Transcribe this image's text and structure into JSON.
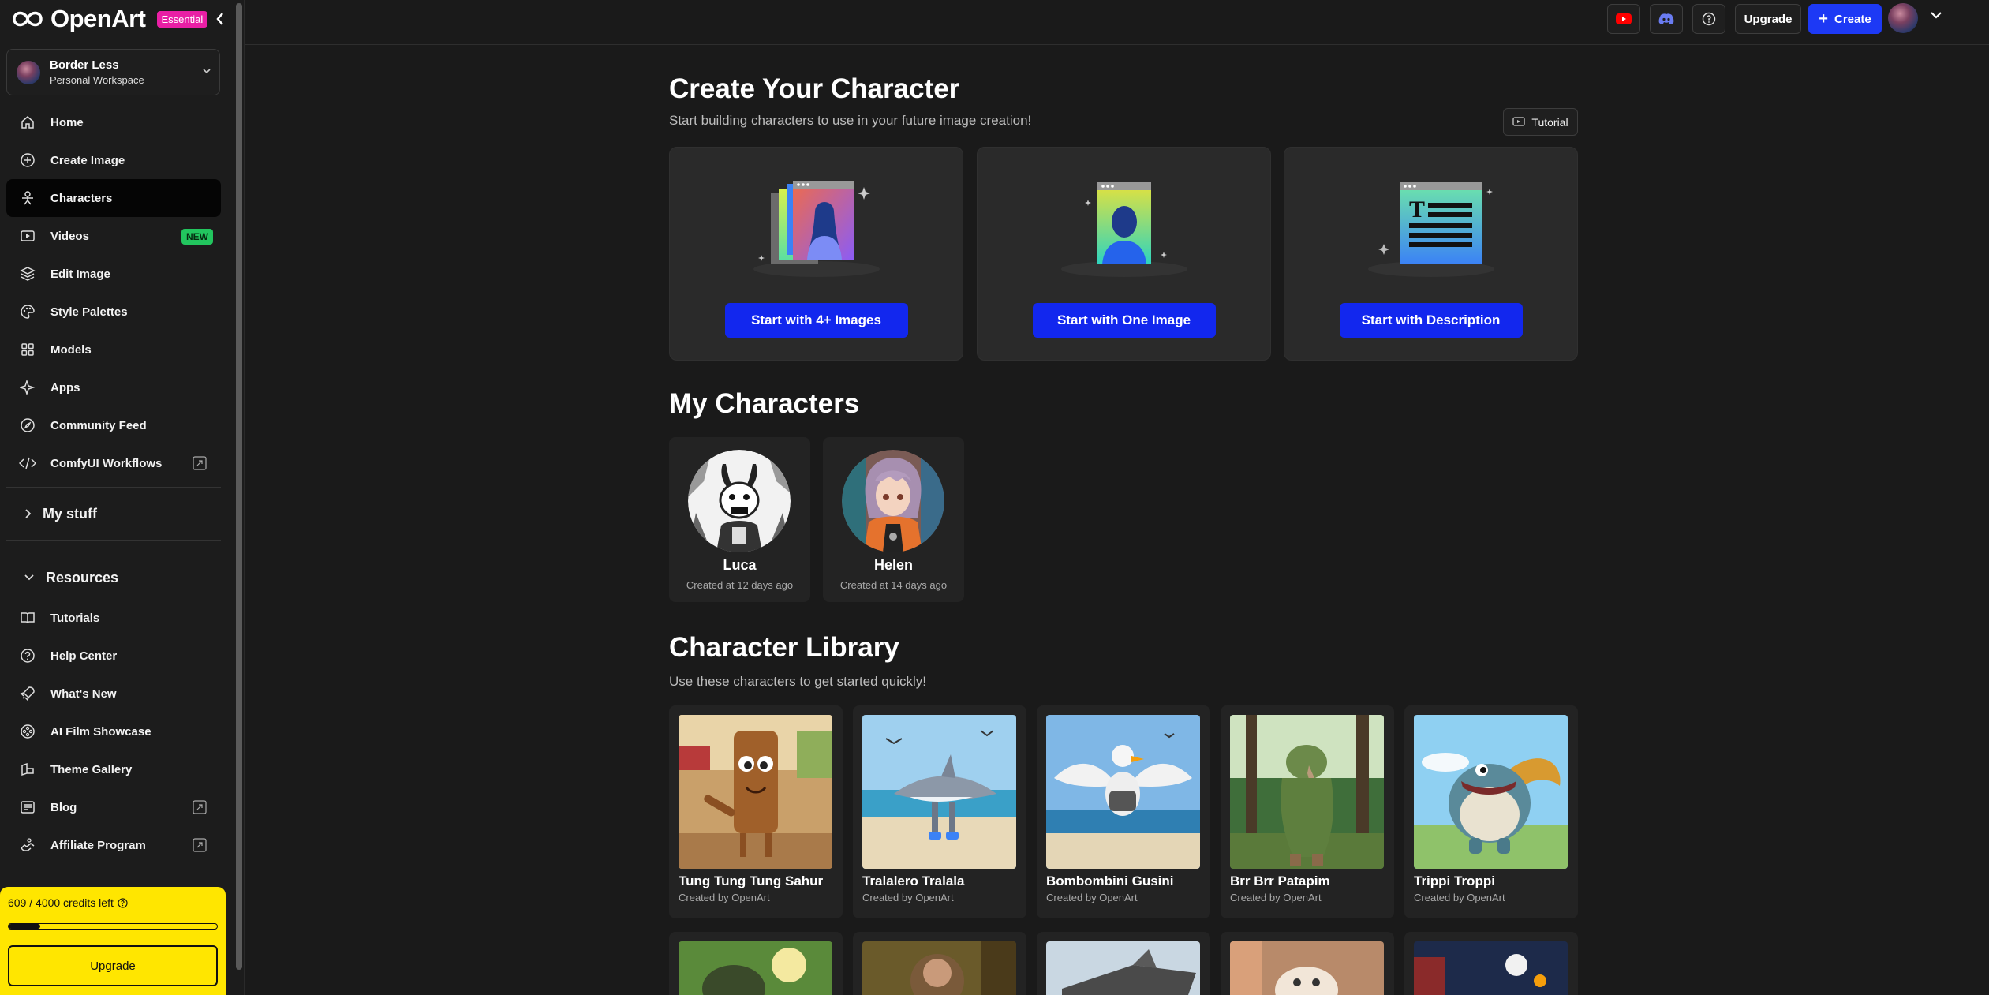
{
  "brand": {
    "name": "OpenArt",
    "plan_badge": "Essential"
  },
  "workspace": {
    "name": "Border Less",
    "type": "Personal Workspace"
  },
  "nav": {
    "items": [
      {
        "label": "Home",
        "icon": "home-icon"
      },
      {
        "label": "Create Image",
        "icon": "plus-circle-icon"
      },
      {
        "label": "Characters",
        "icon": "character-icon",
        "active": true
      },
      {
        "label": "Videos",
        "icon": "video-icon",
        "badge": "NEW"
      },
      {
        "label": "Edit Image",
        "icon": "layers-icon"
      },
      {
        "label": "Style Palettes",
        "icon": "palette-icon"
      },
      {
        "label": "Models",
        "icon": "grid-icon"
      },
      {
        "label": "Apps",
        "icon": "sparkle-icon"
      },
      {
        "label": "Community Feed",
        "icon": "compass-icon"
      },
      {
        "label": "ComfyUI Workflows",
        "icon": "code-icon",
        "external": true
      }
    ],
    "my_stuff": "My stuff",
    "resources_heading": "Resources",
    "resources": [
      {
        "label": "Tutorials",
        "icon": "book-icon"
      },
      {
        "label": "Help Center",
        "icon": "help-icon"
      },
      {
        "label": "What's New",
        "icon": "rocket-icon"
      },
      {
        "label": "AI Film Showcase",
        "icon": "film-reel-icon"
      },
      {
        "label": "Theme Gallery",
        "icon": "gallery-icon"
      },
      {
        "label": "Blog",
        "icon": "blog-icon",
        "external": true
      },
      {
        "label": "Affiliate Program",
        "icon": "handshake-icon",
        "external": true
      }
    ]
  },
  "credits": {
    "text": "609 / 4000 credits left",
    "used_fraction": 0.15,
    "upgrade_label": "Upgrade"
  },
  "topbar": {
    "upgrade_label": "Upgrade",
    "create_label": "Create"
  },
  "create_section": {
    "title": "Create Your Character",
    "subtitle": "Start building characters to use in your future image creation!",
    "tutorial_label": "Tutorial",
    "cards": [
      {
        "button": "Start with 4+ Images"
      },
      {
        "button": "Start with One Image"
      },
      {
        "button": "Start with Description"
      }
    ]
  },
  "my_characters": {
    "title": "My Characters",
    "items": [
      {
        "name": "Luca",
        "created": "Created at 12 days ago"
      },
      {
        "name": "Helen",
        "created": "Created at 14 days ago"
      }
    ]
  },
  "library": {
    "title": "Character Library",
    "subtitle": "Use these characters to get started quickly!",
    "items": [
      {
        "name": "Tung Tung Tung Sahur",
        "by": "Created by OpenArt"
      },
      {
        "name": "Tralalero Tralala",
        "by": "Created by OpenArt"
      },
      {
        "name": "Bombombini Gusini",
        "by": "Created by OpenArt"
      },
      {
        "name": "Brr Brr Patapim",
        "by": "Created by OpenArt"
      },
      {
        "name": "Trippi Troppi",
        "by": "Created by OpenArt"
      }
    ]
  },
  "colors": {
    "accent_blue": "#1227ee",
    "credits_yellow": "#ffe600",
    "badge_pink": "#e91fa5",
    "new_green": "#22c55e"
  }
}
